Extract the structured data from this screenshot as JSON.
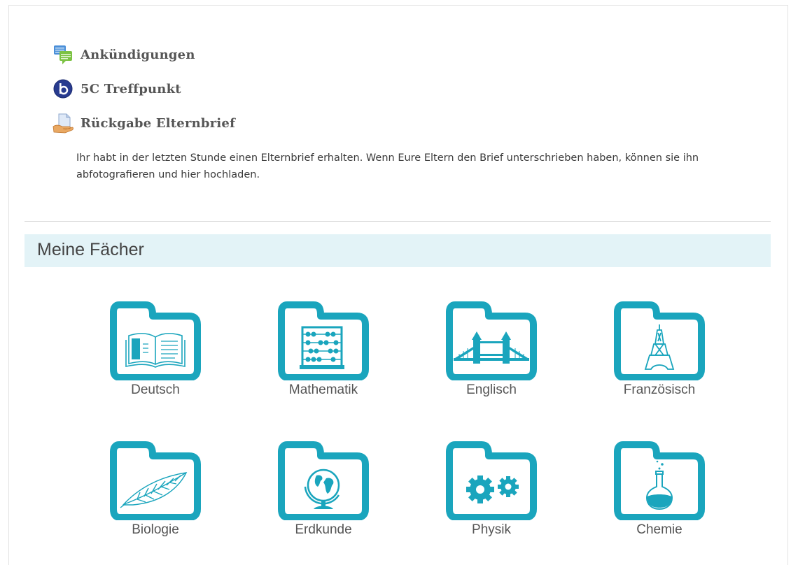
{
  "activities": [
    {
      "title": "Ankündigungen",
      "icon": "forum-icon"
    },
    {
      "title": "5C Treffpunkt",
      "icon": "bigbluebutton-icon"
    },
    {
      "title": "Rückgabe Elternbrief",
      "icon": "assignment-icon"
    }
  ],
  "assignment_description": "Ihr habt in der letzten Stunde einen Elternbrief erhalten. Wenn Eure Eltern den Brief unterschrieben haben, können sie ihn abfotografieren und hier hochladen.",
  "section": {
    "title": "Meine Fächer"
  },
  "subjects": [
    {
      "label": "Deutsch",
      "icon": "book-icon"
    },
    {
      "label": "Mathematik",
      "icon": "abacus-icon"
    },
    {
      "label": "Englisch",
      "icon": "tower-bridge-icon"
    },
    {
      "label": "Französisch",
      "icon": "eiffel-tower-icon"
    },
    {
      "label": "Biologie",
      "icon": "leaf-icon"
    },
    {
      "label": "Erdkunde",
      "icon": "globe-icon"
    },
    {
      "label": "Physik",
      "icon": "gears-icon"
    },
    {
      "label": "Chemie",
      "icon": "flask-icon"
    }
  ],
  "colors": {
    "folder": "#1aa5bd",
    "section_header_bg": "#e3f3f7"
  }
}
